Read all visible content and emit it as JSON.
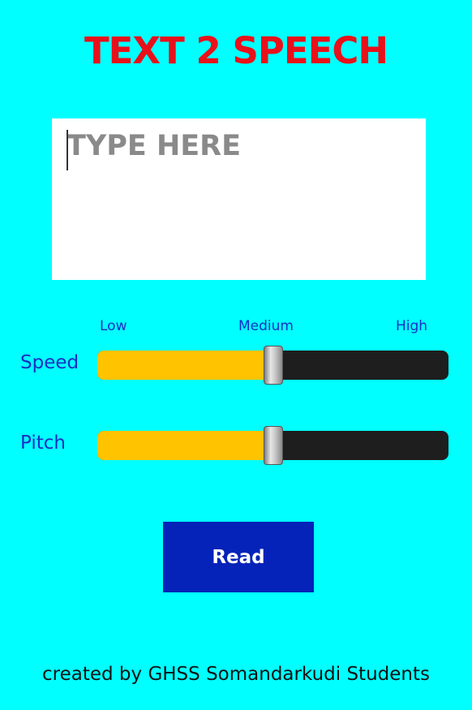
{
  "app": {
    "title": "TEXT 2 SPEECH"
  },
  "text_input": {
    "value": "",
    "placeholder": "TYPE HERE"
  },
  "scale_labels": {
    "low": "Low",
    "medium": "Medium",
    "high": "High"
  },
  "speed": {
    "label": "Speed",
    "value": 0.5
  },
  "pitch": {
    "label": "Pitch",
    "value": 0.5
  },
  "read_button": {
    "label": "Read"
  },
  "footer": {
    "text": "created by GHSS Somandarkudi Students"
  },
  "colors": {
    "background": "#00FFFF",
    "title": "#E8111A",
    "labels": "#1A2FC2",
    "slider_fill": "#FFC300",
    "slider_track": "#1E1E1E",
    "button": "#0523B8",
    "button_text": "#FFFFFF"
  }
}
